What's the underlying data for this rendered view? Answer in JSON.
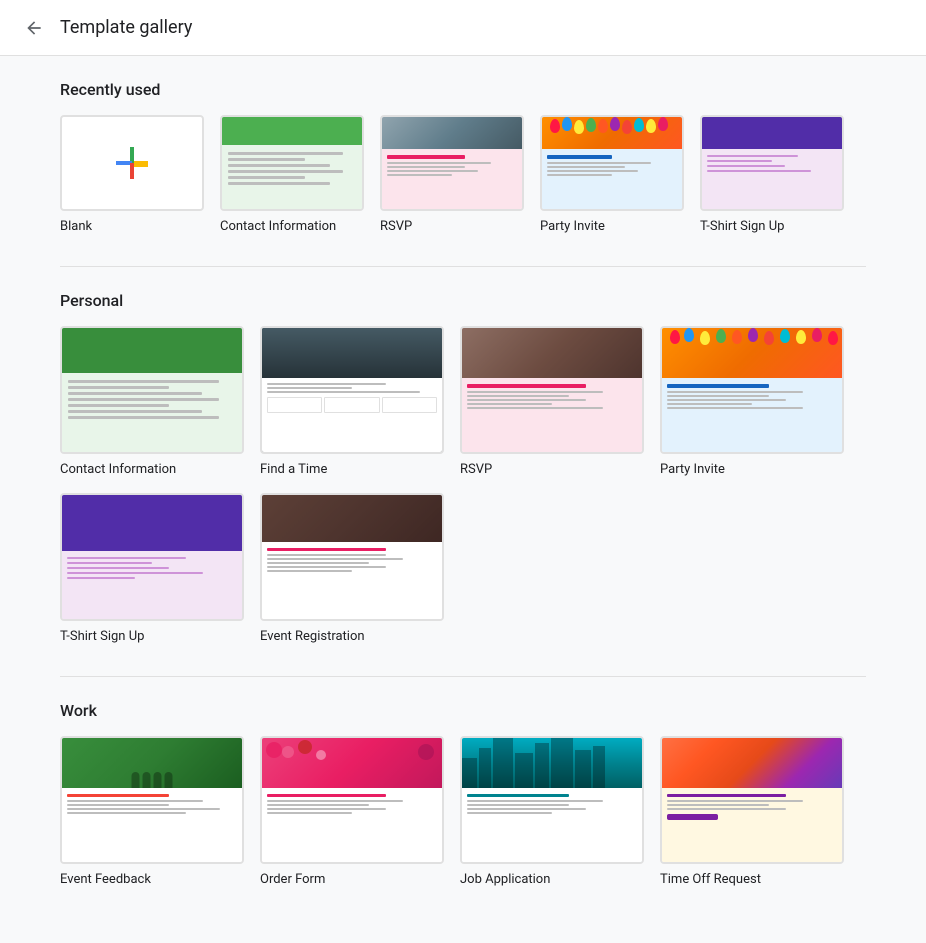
{
  "header": {
    "back_label": "←",
    "title": "Template gallery"
  },
  "recently_used": {
    "section_title": "Recently used",
    "templates": [
      {
        "id": "blank",
        "label": "Blank"
      },
      {
        "id": "contact-info",
        "label": "Contact Information"
      },
      {
        "id": "rsvp",
        "label": "RSVP"
      },
      {
        "id": "party-invite",
        "label": "Party Invite"
      },
      {
        "id": "tshirt-signup",
        "label": "T-Shirt Sign Up"
      }
    ]
  },
  "personal": {
    "section_title": "Personal",
    "templates": [
      {
        "id": "contact-info-p",
        "label": "Contact Information"
      },
      {
        "id": "find-a-time",
        "label": "Find a Time"
      },
      {
        "id": "rsvp-p",
        "label": "RSVP"
      },
      {
        "id": "party-invite-p",
        "label": "Party Invite"
      },
      {
        "id": "tshirt-signup-p",
        "label": "T-Shirt Sign Up"
      },
      {
        "id": "event-registration",
        "label": "Event Registration"
      }
    ]
  },
  "work": {
    "section_title": "Work",
    "templates": [
      {
        "id": "event-feedback",
        "label": "Event Feedback"
      },
      {
        "id": "order-form",
        "label": "Order Form"
      },
      {
        "id": "job-application",
        "label": "Job Application"
      },
      {
        "id": "time-off-request",
        "label": "Time Off Request"
      }
    ]
  }
}
